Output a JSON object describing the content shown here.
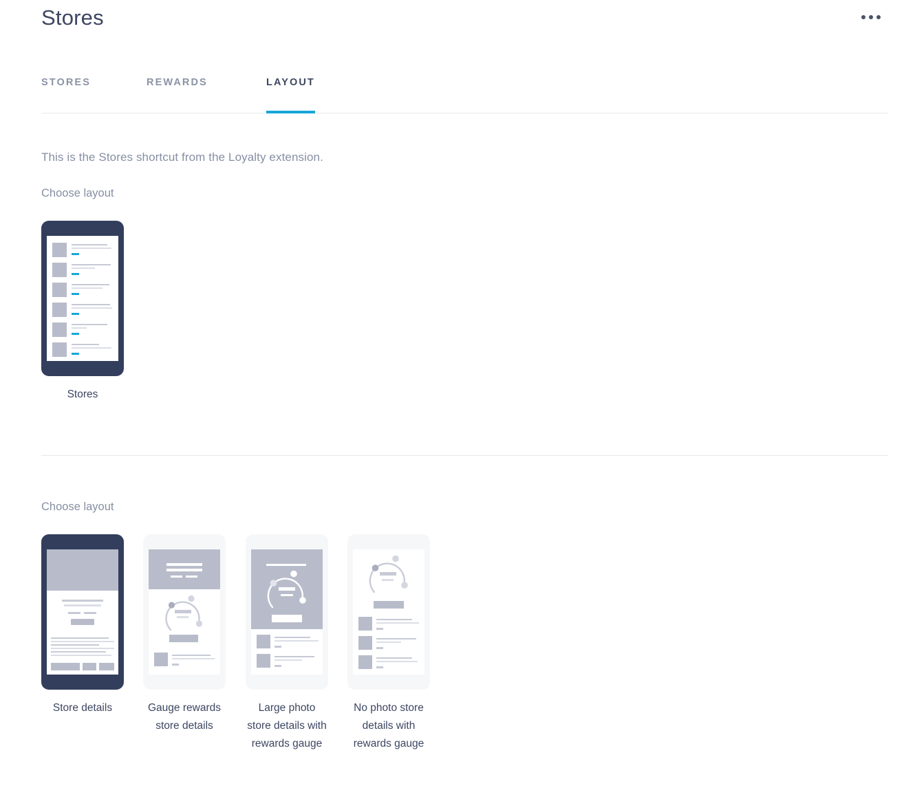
{
  "header": {
    "title": "Stores",
    "overflow_icon": "overflow-dots-icon"
  },
  "tabs": [
    {
      "label": "STORES",
      "active": false
    },
    {
      "label": "REWARDS",
      "active": false
    },
    {
      "label": "LAYOUT",
      "active": true
    }
  ],
  "body": {
    "intro": "This is the Stores shortcut from the Loyalty extension.",
    "choose_layout_1": "Choose layout",
    "choose_layout_2": "Choose layout"
  },
  "layout_section_1": {
    "options": [
      {
        "label": "Stores",
        "selected": true
      }
    ]
  },
  "layout_section_2": {
    "options": [
      {
        "label": "Store details",
        "selected": true
      },
      {
        "label": "Gauge rewards store details",
        "selected": false
      },
      {
        "label": "Large photo store details with rewards gauge",
        "selected": false
      },
      {
        "label": "No photo store details with rewards gauge",
        "selected": false
      }
    ]
  },
  "colors": {
    "accent_blue": "#19a6d8",
    "selected_frame": "#333e5d",
    "unselected_frame": "#f6f7f9",
    "text_dark": "#3d4661",
    "text_muted": "#868fa3",
    "wireframe_gray": "#b8bcca",
    "divider": "#e6e8ec"
  }
}
